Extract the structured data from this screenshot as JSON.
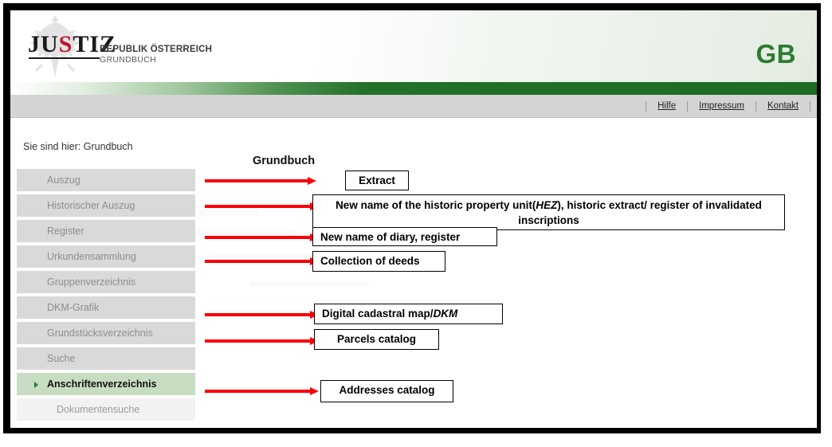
{
  "header": {
    "logo_text_pre": "JU",
    "logo_text_s": "S",
    "logo_text_post": "TIZ",
    "title_line1": "REPUBLIK ÖSTERREICH",
    "title_line2": "GRUNDBUCH",
    "brand_mark": "GB",
    "eagle_icon": "austrian-eagle-icon",
    "brand_color": "#2a7d2e",
    "accent_red": "#fb0007"
  },
  "linkbar": {
    "links": [
      {
        "label": "Hilfe"
      },
      {
        "label": "Impressum"
      },
      {
        "label": "Kontakt"
      }
    ]
  },
  "content": {
    "breadcrumb": "Sie sind hier: Grundbuch",
    "page_heading": "Grundbuch"
  },
  "sidebar": {
    "items": [
      {
        "label": "Auszug",
        "active": false
      },
      {
        "label": "Historischer Auszug",
        "active": false
      },
      {
        "label": "Register",
        "active": false
      },
      {
        "label": "Urkundensammlung",
        "active": false
      },
      {
        "label": "Gruppenverzeichnis",
        "active": false
      },
      {
        "label": "DKM-Grafik",
        "active": false
      },
      {
        "label": "Grundstücksverzeichnis",
        "active": false
      },
      {
        "label": "Suche",
        "active": false
      },
      {
        "label": "Anschriftenverzeichnis",
        "active": true
      },
      {
        "label": "Dokumentensuche",
        "active": false
      }
    ]
  },
  "annotations": [
    {
      "id": "extract",
      "text": "Extract"
    },
    {
      "id": "historic",
      "text_part1": "New name of the historic property unit(",
      "text_italic": "HEZ",
      "text_part2": "), historic extract/ register of invalidated inscriptions"
    },
    {
      "id": "diary",
      "text": "New name of diary, register"
    },
    {
      "id": "deeds",
      "text": "Collection of deeds"
    },
    {
      "id": "dkm",
      "text_part1": "Digital cadastral map/",
      "text_italic": "DKM",
      "text_part2": ""
    },
    {
      "id": "parcels",
      "text": "Parcels catalog"
    },
    {
      "id": "addresses",
      "text": "Addresses catalog"
    }
  ]
}
